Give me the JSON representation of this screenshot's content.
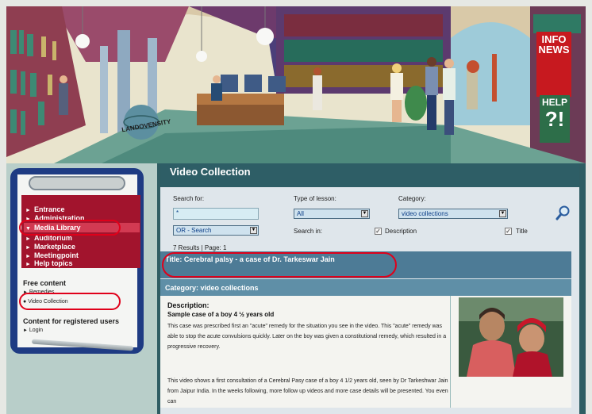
{
  "hero": {
    "globe_text": "LANDOVENSITY",
    "info_news": [
      "INFO",
      "NEWS"
    ],
    "help": {
      "label": "HELP",
      "mark": "?!"
    }
  },
  "nav": {
    "items": [
      {
        "label": "Entrance"
      },
      {
        "label": "Administration"
      },
      {
        "label": "Media Library"
      },
      {
        "label": "Auditorium"
      },
      {
        "label": "Marketplace"
      },
      {
        "label": "Meetingpoint"
      },
      {
        "label": "Help topics"
      }
    ],
    "free_content": {
      "title": "Free content",
      "items": [
        "Remedies",
        "Video Collection"
      ]
    },
    "registered": {
      "title": "Content for registered users",
      "items": [
        "Login"
      ]
    }
  },
  "page": {
    "title": "Video Collection"
  },
  "search": {
    "search_for_label": "Search for:",
    "search_value": "*",
    "mode_value": "OR - Search",
    "type_label": "Type of lesson:",
    "type_value": "All",
    "category_label": "Category:",
    "category_value": "video collections",
    "search_in_label": "Search in:",
    "description_label": "Description",
    "title_label": "Title",
    "description_checked": true,
    "title_checked": true
  },
  "results": {
    "summary": "7 Results | Page:  1",
    "item": {
      "title": "Title: Cerebral palsy  - a case of Dr. Tarkeswar Jain",
      "category": "Category: video collections",
      "description_label": "Description:",
      "subtitle": "Sample case of a boy 4 ½ years old",
      "paragraph1": "This case was prescribed first an \"acute\" remedy for the situation you see in the video. This \"acute\" remedy was able to stop the acute convulsions quickly. Later on the boy was given a constitutional remedy, which resulted in a progressive recovery.",
      "paragraph2": "This video shows a first consultation of a Cerebral Pasy case of a boy 4 1/2 years old, seen by Dr Tarkeshwar Jain from Jaipur India. In the weeks following, more follow up videos and more case details will be presented. You even can"
    }
  },
  "colors": {
    "nav_red": "#a2142d",
    "clipboard_blue": "#1e3b83",
    "header_teal": "#2e5e66",
    "title_bar": "#4d7b96",
    "highlight_ring": "#e0001a"
  }
}
